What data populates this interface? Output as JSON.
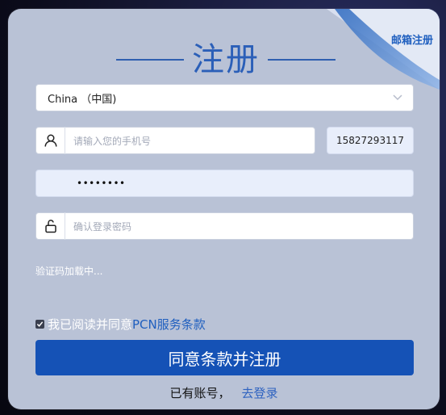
{
  "header": {
    "title": "注册",
    "corner_link": "邮箱注册"
  },
  "form": {
    "country_select": {
      "value": "China （中国)",
      "icon": "chevron-down-icon"
    },
    "phone": {
      "placeholder": "请输入您的手机号",
      "icon": "user-icon",
      "chip_value": "15827293117"
    },
    "password": {
      "masked_value": "••••••••"
    },
    "confirm_password": {
      "placeholder": "确认登录密码",
      "icon": "lock-icon"
    },
    "captcha_status": "验证码加载中...",
    "agreement": {
      "text": "我已阅读并同意",
      "link": "PCN服务条款",
      "checked": true
    },
    "submit_label": "同意条款并注册"
  },
  "footer": {
    "have_account_text": "已有账号，",
    "login_link": "去登录"
  },
  "colors": {
    "card_bg": "#b9c2d6",
    "accent_blue": "#1552b6",
    "title_blue": "#2b5fb8"
  }
}
